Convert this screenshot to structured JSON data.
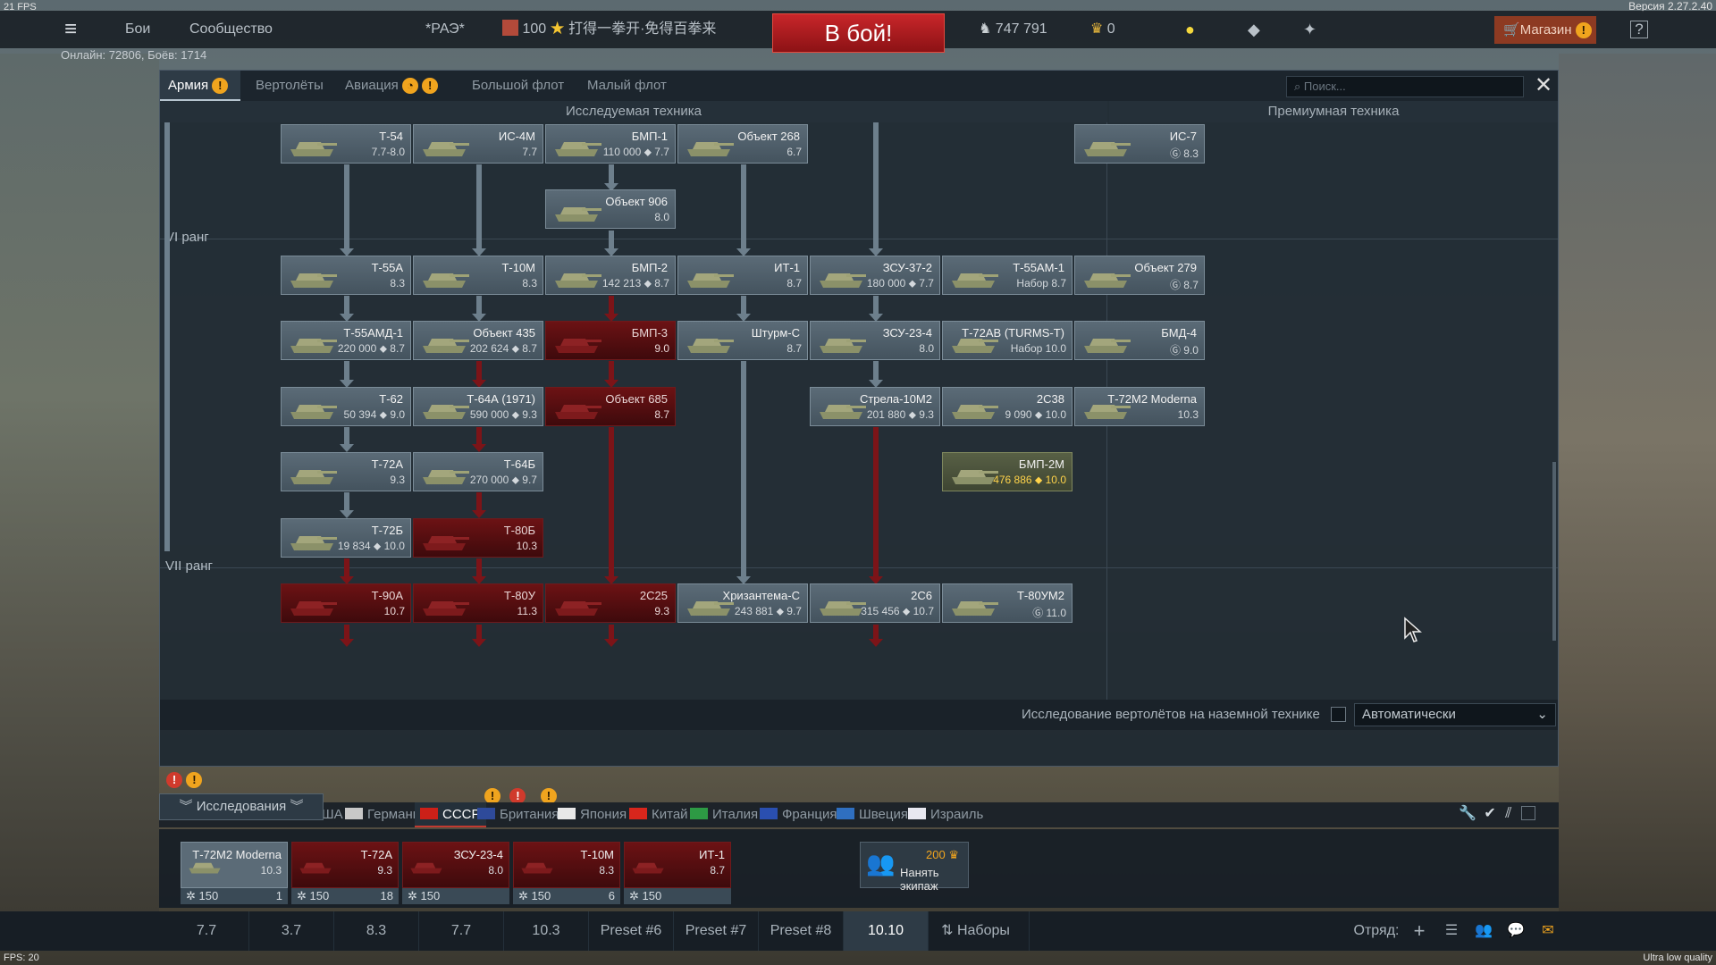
{
  "hud": {
    "fps_top": "21 FPS",
    "version": "Версия 2.27.2.40",
    "fps_bottom": "FPS: 20",
    "quality": "Ultra low quality"
  },
  "topbar": {
    "menu_icon": "hamburger-icon",
    "battles": "Бои",
    "community": "Сообщество",
    "squad_tag": "*РАЭ*",
    "promo_amount": "100",
    "promo_text": "打得一拳开·免得百拳来",
    "battle_button": "В бой!",
    "silver_lions": "747 791",
    "golden_eagles": "0",
    "shop": "Магазин"
  },
  "online": "Онлайн: 72806, Боёв: 1714",
  "tabs": [
    {
      "label": "Армия",
      "active": true
    },
    {
      "label": "Вертолёты"
    },
    {
      "label": "Авиация"
    },
    {
      "label": "Большой флот"
    },
    {
      "label": "Малый флот"
    }
  ],
  "search_placeholder": "Поиск...",
  "headers": {
    "researched": "Исследуемая техника",
    "premium": "Премиумная техника"
  },
  "ranks": {
    "r6": "VI ранг",
    "r7": "VII ранг"
  },
  "vehicles": [
    {
      "name": "Т-54",
      "info": "7.7-8.0",
      "state": "grey",
      "c": 0,
      "r": 0
    },
    {
      "name": "ИС-4М",
      "info": "7.7",
      "state": "grey",
      "c": 1,
      "r": 0
    },
    {
      "name": "БМП-1",
      "info": "110 000 ⬥ 7.7",
      "state": "grey",
      "c": 2,
      "r": 0
    },
    {
      "name": "Объект 268",
      "info": "6.7",
      "state": "grey",
      "c": 3,
      "r": 0
    },
    {
      "name": "ИС-7",
      "info": "Ⓖ 8.3",
      "state": "grey",
      "c": 6,
      "r": 0
    },
    {
      "name": "Объект 906",
      "info": "8.0",
      "state": "grey",
      "c": 2,
      "r": 1
    },
    {
      "name": "Т-55А",
      "info": "8.3",
      "state": "grey",
      "c": 0,
      "r": 2
    },
    {
      "name": "Т-10М",
      "info": "8.3",
      "state": "grey",
      "c": 1,
      "r": 2
    },
    {
      "name": "БМП-2",
      "info": "142 213 ⬥ 8.7",
      "state": "grey",
      "c": 2,
      "r": 2
    },
    {
      "name": "ИТ-1",
      "info": "8.7",
      "state": "grey",
      "c": 3,
      "r": 2
    },
    {
      "name": "ЗСУ-37-2",
      "info": "180 000 ⬥ 7.7",
      "state": "grey",
      "c": 4,
      "r": 2
    },
    {
      "name": "Т-55АМ-1",
      "info": "Набор 8.7",
      "state": "grey",
      "c": 5,
      "r": 2
    },
    {
      "name": "Объект 279",
      "info": "Ⓖ 8.7",
      "state": "grey",
      "c": 6,
      "r": 2
    },
    {
      "name": "Т-55АМД-1",
      "info": "220 000 ⬥ 8.7",
      "state": "grey",
      "c": 0,
      "r": 3
    },
    {
      "name": "Объект 435",
      "info": "202 624 ⬥ 8.7",
      "state": "grey",
      "c": 1,
      "r": 3
    },
    {
      "name": "БМП-3",
      "info": "9.0",
      "state": "red",
      "c": 2,
      "r": 3
    },
    {
      "name": "Штурм-С",
      "info": "8.7",
      "state": "grey",
      "c": 3,
      "r": 3
    },
    {
      "name": "ЗСУ-23-4",
      "info": "8.0",
      "state": "grey",
      "c": 4,
      "r": 3
    },
    {
      "name": "Т-72АВ (TURMS-T)",
      "info": "Набор 10.0",
      "state": "grey",
      "c": 5,
      "r": 3
    },
    {
      "name": "БМД-4",
      "info": "Ⓖ 9.0",
      "state": "grey",
      "c": 6,
      "r": 3
    },
    {
      "name": "Т-62",
      "info": "50 394 ⬥ 9.0",
      "state": "grey",
      "c": 0,
      "r": 4
    },
    {
      "name": "Т-64А (1971)",
      "info": "590 000 ⬥ 9.3",
      "state": "grey",
      "c": 1,
      "r": 4
    },
    {
      "name": "Объект 685",
      "info": "8.7",
      "state": "red",
      "c": 2,
      "r": 4
    },
    {
      "name": "Стрела-10М2",
      "info": "201 880 ⬥ 9.3",
      "state": "grey",
      "c": 4,
      "r": 4
    },
    {
      "name": "2С38",
      "info": "9 090 ⬥ 10.0",
      "state": "grey",
      "c": 5,
      "r": 4
    },
    {
      "name": "Т-72М2 Moderna",
      "info": "10.3",
      "state": "grey",
      "c": 6,
      "r": 4
    },
    {
      "name": "Т-72А",
      "info": "9.3",
      "state": "grey",
      "c": 0,
      "r": 5
    },
    {
      "name": "Т-64Б",
      "info": "270 000 ⬥ 9.7",
      "state": "grey",
      "c": 1,
      "r": 5
    },
    {
      "name": "БМП-2М",
      "info": "476 886 ⬥ 10.0",
      "state": "olive",
      "c": 5,
      "r": 5
    },
    {
      "name": "Т-72Б",
      "info": "19 834 ⬥ 10.0",
      "state": "grey",
      "c": 0,
      "r": 6
    },
    {
      "name": "Т-80Б",
      "info": "10.3",
      "state": "red",
      "c": 1,
      "r": 6
    },
    {
      "name": "Т-90А",
      "info": "10.7",
      "state": "red",
      "c": 0,
      "r": 7
    },
    {
      "name": "Т-80У",
      "info": "11.3",
      "state": "red",
      "c": 1,
      "r": 7
    },
    {
      "name": "2С25",
      "info": "9.3",
      "state": "red",
      "c": 2,
      "r": 7
    },
    {
      "name": "Хризантема-С",
      "info": "243 881 ⬥ 9.7",
      "state": "grey",
      "c": 3,
      "r": 7
    },
    {
      "name": "2С6",
      "info": "315 456 ⬥ 10.7",
      "state": "grey",
      "c": 4,
      "r": 7
    },
    {
      "name": "Т-80УМ2",
      "info": "Ⓖ 11.0",
      "state": "grey",
      "c": 5,
      "r": 7
    }
  ],
  "heli_research": "Исследование вертолётов на наземной технике",
  "auto_select": "Автоматически",
  "research_button": "Исследования",
  "nations": [
    {
      "label": "США"
    },
    {
      "label": "Германия"
    },
    {
      "label": "СССР",
      "active": true
    },
    {
      "label": "Британия"
    },
    {
      "label": "Япония"
    },
    {
      "label": "Китай"
    },
    {
      "label": "Италия"
    },
    {
      "label": "Франция"
    },
    {
      "label": "Швеция"
    },
    {
      "label": "Израиль"
    }
  ],
  "crew": [
    {
      "name": "Т-72М2 Moderna",
      "br": "10.3",
      "cost": "150",
      "extra": "1",
      "state": "grey"
    },
    {
      "name": "Т-72А",
      "br": "9.3",
      "cost": "150",
      "extra": "18",
      "state": "red"
    },
    {
      "name": "ЗСУ-23-4",
      "br": "8.0",
      "cost": "150",
      "extra": "",
      "state": "red"
    },
    {
      "name": "Т-10М",
      "br": "8.3",
      "cost": "150",
      "extra": "6",
      "state": "red"
    },
    {
      "name": "ИТ-1",
      "br": "8.7",
      "cost": "150",
      "extra": "",
      "state": "red"
    }
  ],
  "hire": {
    "cost": "200",
    "label": "Нанять экипаж"
  },
  "presets": [
    "7.7",
    "3.7",
    "8.3",
    "7.7",
    "10.3",
    "Preset #6",
    "Preset #7",
    "Preset #8",
    "10.10"
  ],
  "presets_active": "10.10",
  "sets_label": "Наборы",
  "squad_label": "Отряд:",
  "colors": {
    "accent_red": "#c8262a",
    "warning": "#f0a41e",
    "locked": "#7c1418"
  }
}
